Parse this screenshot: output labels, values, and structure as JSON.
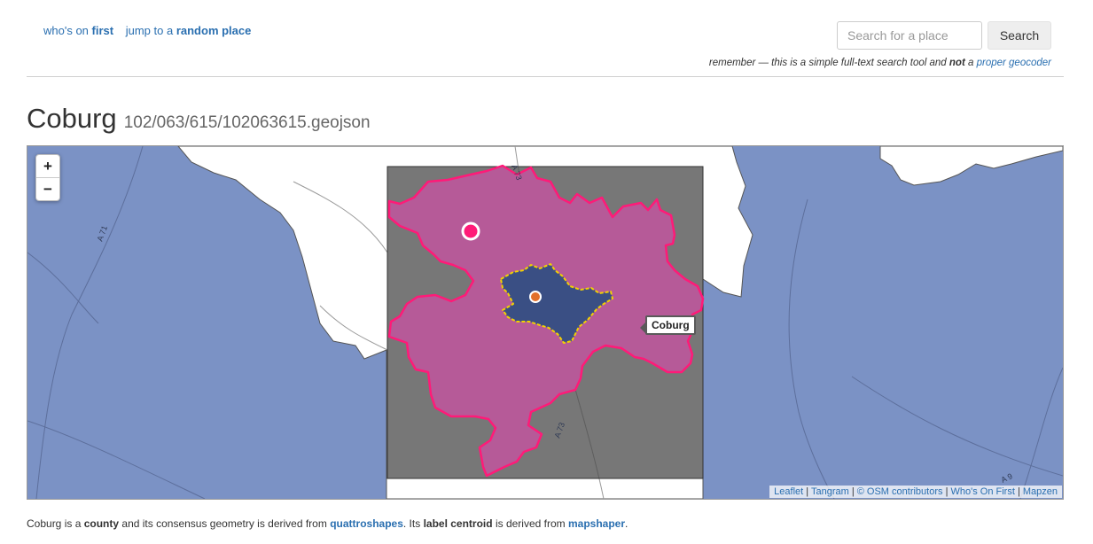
{
  "nav": {
    "whos_prefix": "who's on",
    "whos_bold": "first",
    "jump_prefix": "jump to a",
    "jump_bold": "random place"
  },
  "search": {
    "placeholder": "Search for a place",
    "button_label": "Search"
  },
  "remember": {
    "prefix": "remember — this is a simple full-text search tool and",
    "bold": "not",
    "mid": "a",
    "link": "proper geocoder"
  },
  "title": {
    "name": "Coburg",
    "path": "102/063/615/102063615.geojson"
  },
  "map": {
    "zoom_in": "+",
    "zoom_out": "−",
    "tooltip": "Coburg",
    "road_labels": [
      "A 73",
      "A 71",
      "A 73",
      "A 9"
    ],
    "attribution": [
      "Leaflet",
      "Tangram",
      "© OSM contributors",
      "Who's On First",
      "Mapzen"
    ],
    "attribution_sep": "|",
    "colors": {
      "outside_fill": "#7b92c5",
      "outside_land": "#ffffff",
      "bbox_fill": "#4a4a4a",
      "county_fill": "#b65a98",
      "county_stroke": "#ff1a78",
      "city_fill": "#3a4f84",
      "city_stroke": "#f2d200",
      "label_centroid": "#ff1a78",
      "geom_centroid": "#e2702b"
    }
  },
  "footer": {
    "t1": "Coburg is a",
    "placetype": "county",
    "t2": "and its consensus geometry is derived from",
    "source": "quattroshapes",
    "t3": ". Its",
    "lc": "label centroid",
    "t4": "is derived from",
    "lc_source": "mapshaper",
    "t5": "."
  }
}
